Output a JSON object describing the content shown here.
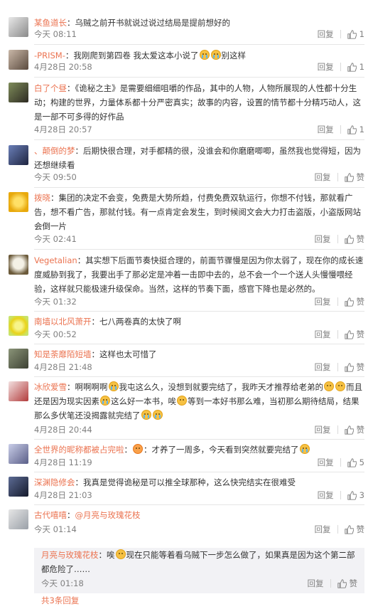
{
  "actions": {
    "reply": "回复",
    "like_placeholder": "赞"
  },
  "comments": [
    {
      "user": "某鱼道长",
      "text": "乌贼之前开书就说过说过结局是提前想好的",
      "time": "今天 08:11",
      "likes": "1"
    },
    {
      "user": "-PRISM-",
      "text_a": "我刚爬到第四卷 我太爱这本小说了",
      "text_b": "别这样",
      "time": "4月28日 20:58",
      "likes": "1"
    },
    {
      "user": "白了个昼",
      "text": "《诡秘之主》是需要细细咀嚼的作品，其中的人物，人物所展现的人性都十分生动；构建的世界，力量体系都十分严密真实；故事的内容，设置的情节都十分精巧动人，这是一部不可多得的好作品",
      "time": "4月28日 20:57",
      "likes": "1"
    },
    {
      "user": "、颠倒的梦",
      "text": "后期快很合理，对手都精的很，没谁会和你磨磨唧唧，虽然我也觉得短，因为还想继续看",
      "time": "今天 09:50",
      "likes": "赞"
    },
    {
      "user": "拨晓",
      "text": "集团的决定不会变，免费是大势所趋，付费免费双轨运行，你想不付钱，那就看广告，想不看广告，那就付钱。有一点肯定会发生，到时候阅文会大力打击盗版，小盗版网站会倒一片",
      "time": "今天 02:41",
      "likes": "赞"
    },
    {
      "user": "Vegetalian",
      "text": "其实想下后面节奏快挺合理的，前面节骤慢是因为你太弱了，现在你的成长速度威胁到我了，我要出手了那必定是冲着一击即中去的，总不会一个一个送人头慢慢喂经验，这样就只能极速升级保命。当然，这样的节奏下面，感官下降也是必然的。",
      "time": "今天 01:32",
      "likes": "赞"
    },
    {
      "user": "南墙以北风萧开",
      "text": "七八两卷真的太快了啊",
      "time": "今天 00:52",
      "likes": "赞"
    },
    {
      "user": "知是荼靡陌短墙",
      "text": "这样也太可惜了",
      "time": "4月28日 21:48",
      "likes": "赞"
    },
    {
      "user": "冰欣爱雪",
      "text_a": "啊啊啊啊",
      "text_b": "我屯这么久，没想到就要完结了，我昨天才推荐给老弟的",
      "text_c": "而且还是因为现实因素",
      "text_d": "这么好一本书，唉",
      "text_e": "等到一本好书那么难，当初那么期待结局，结果那么多伏笔还没揭露就完结了",
      "time": "4月28日 20:44",
      "likes": "赞"
    },
    {
      "user": "全世界的昵称都被占完啦",
      "text_a": "才养了一周多，今天看到突然就要完结了",
      "time": "4月28日 11:19",
      "likes": "5"
    },
    {
      "user": "深渊隐修会",
      "text": "我真是觉得诡秘是可以推全球那种，这么快完结实在很难受",
      "time": "4月28日 21:03",
      "likes": "3"
    },
    {
      "user": "古代嘻嘻",
      "mention": "@月亮与玫瑰花枝",
      "time": "今天 01:14",
      "likes": "赞"
    }
  ],
  "sub_reply": {
    "user": "月亮与玫瑰花枝",
    "text_a": "唉",
    "text_b": "现在只能等着看乌贼下一步怎么做了，如果真是因为这个第二部都危险了……",
    "time": "今天 01:18",
    "likes": "赞"
  },
  "total_replies": "共3条回复",
  "colors": {
    "username": "#eb7350",
    "meta": "#808080",
    "divider": "#e6e6e6"
  }
}
